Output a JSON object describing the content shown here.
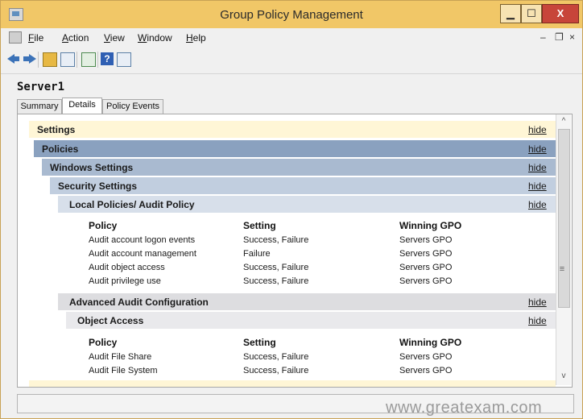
{
  "window": {
    "title": "Group Policy Management"
  },
  "title_buttons": {
    "minimize": "▁",
    "maximize": "☐",
    "close": "X"
  },
  "menubar": {
    "items": [
      {
        "underline": "F",
        "rest": "ile"
      },
      {
        "underline": "A",
        "rest": "ction"
      },
      {
        "underline": "V",
        "rest": "iew"
      },
      {
        "underline": "W",
        "rest": "indow"
      },
      {
        "underline": "H",
        "rest": "elp"
      }
    ],
    "mdi_controls": {
      "minimize": "–",
      "restore": "❐",
      "close": "×"
    }
  },
  "toolbar": {
    "icons": [
      "back-arrow-icon",
      "forward-arrow-icon",
      "folder-up-icon",
      "console-tree-icon",
      "refresh-icon",
      "help-icon",
      "show-action-pane-icon"
    ],
    "help_glyph": "?"
  },
  "server": "Server1",
  "tabs": [
    {
      "label": "Summary"
    },
    {
      "label": "Details"
    },
    {
      "label": "Policy Events"
    }
  ],
  "sections": {
    "settings": {
      "label": "Settings",
      "link": "hide"
    },
    "policies": {
      "label": "Policies",
      "link": "hide"
    },
    "windows_settings": {
      "label": "Windows Settings",
      "link": "hide"
    },
    "security_settings": {
      "label": "Security Settings",
      "link": "hide"
    },
    "audit_policy": {
      "label": "Local Policies/ Audit Policy",
      "link": "hide"
    },
    "advanced_audit": {
      "label": "Advanced Audit Configuration",
      "link": "hide"
    },
    "object_access": {
      "label": "Object Access",
      "link": "hide"
    }
  },
  "audit_table": {
    "columns": [
      "Policy",
      "Setting",
      "Winning GPO"
    ],
    "rows": [
      [
        "Audit account logon events",
        "Success, Failure",
        "Servers GPO"
      ],
      [
        "Audit account management",
        "Failure",
        "Servers GPO"
      ],
      [
        "Audit object access",
        "Success, Failure",
        "Servers GPO"
      ],
      [
        "Audit privilege use",
        "Success, Failure",
        "Servers GPO"
      ]
    ]
  },
  "object_access_table": {
    "columns": [
      "Policy",
      "Setting",
      "Winning GPO"
    ],
    "rows": [
      [
        "Audit File Share",
        "Success, Failure",
        "Servers GPO"
      ],
      [
        "Audit File System",
        "Success, Failure",
        "Servers GPO"
      ]
    ]
  },
  "scrollbar": {
    "up": "^",
    "down": "v",
    "grip": "≡"
  },
  "watermark": "www.greatexam.com"
}
